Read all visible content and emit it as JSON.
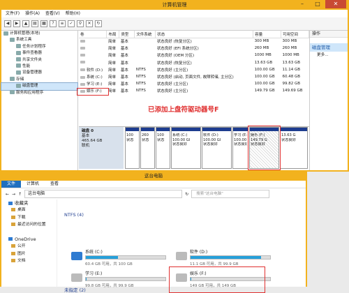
{
  "cm": {
    "title": "计算机管理",
    "menu": [
      "文件(F)",
      "操作(A)",
      "查看(V)",
      "帮助(H)"
    ],
    "tree": [
      {
        "label": "计算机管理(本地)",
        "indent": 0
      },
      {
        "label": "系统工具",
        "indent": 1
      },
      {
        "label": "任务计划程序",
        "indent": 2
      },
      {
        "label": "事件查看器",
        "indent": 2
      },
      {
        "label": "共享文件夹",
        "indent": 2
      },
      {
        "label": "性能",
        "indent": 2
      },
      {
        "label": "设备管理器",
        "indent": 2
      },
      {
        "label": "存储",
        "indent": 1
      },
      {
        "label": "磁盘管理",
        "indent": 2,
        "selected": true
      },
      {
        "label": "服务和应用程序",
        "indent": 1
      }
    ],
    "columns": [
      "卷",
      "布局",
      "类型",
      "文件系统",
      "状态",
      "容量",
      "可用空间"
    ],
    "rows": [
      [
        "",
        "简单",
        "基本",
        "",
        "状态良好 (恢复分区)",
        "300 MB",
        "300 MB"
      ],
      [
        "",
        "简单",
        "基本",
        "",
        "状态良好 (EFI 系统分区)",
        "260 MB",
        "260 MB"
      ],
      [
        "",
        "简单",
        "基本",
        "",
        "状态良好 (OEM 分区)",
        "1000 MB",
        "1000 MB"
      ],
      [
        "",
        "简单",
        "基本",
        "",
        "状态良好 (恢复分区)",
        "13.63 GB",
        "13.63 GB"
      ],
      [
        "软件 (D:)",
        "简单",
        "基本",
        "NTFS",
        "状态良好 (主分区)",
        "100.00 GB",
        "11.14 GB"
      ],
      [
        "系统 (C:)",
        "简单",
        "基本",
        "NTFS",
        "状态良好 (启动, 页面文件, 故障转储, 主分区)",
        "100.00 GB",
        "60.48 GB"
      ],
      [
        "学习 (E:)",
        "简单",
        "基本",
        "NTFS",
        "状态良好 (主分区)",
        "100.00 GB",
        "99.82 GB"
      ],
      [
        "娱乐 (F:)",
        "简单",
        "基本",
        "NTFS",
        "状态良好 (主分区)",
        "149.79 GB",
        "149.69 GB"
      ]
    ],
    "annotation": "已添加上盘符驱动器号F",
    "disk": {
      "name": "磁盘 0",
      "kind": "基本",
      "size": "465.64 GB",
      "status": "联机"
    },
    "partitions": [
      {
        "lines": [
          "",
          "100",
          "状态"
        ],
        "hatch": false
      },
      {
        "lines": [
          "",
          "260",
          "状态"
        ],
        "hatch": false
      },
      {
        "lines": [
          "",
          "100",
          "状态"
        ],
        "hatch": false
      },
      {
        "lines": [
          "系统 (C:)",
          "100.00 GI",
          "状态良好"
        ],
        "hatch": false
      },
      {
        "lines": [
          "软件 (D:)",
          "100.00 GI",
          "状态良好"
        ],
        "hatch": false
      },
      {
        "lines": [
          "学习 (E:)",
          "100.00 GI",
          "状态良好"
        ],
        "hatch": false
      },
      {
        "lines": [
          "娱乐  (F:)",
          "149.79 G",
          "状态良好"
        ],
        "hatch": true
      },
      {
        "lines": [
          "",
          "13.63 G",
          "状态良好"
        ],
        "hatch": false
      }
    ],
    "ops": {
      "header": "操作",
      "section": "磁盘管理",
      "more": "更多..."
    }
  },
  "pc": {
    "title": "这台电脑",
    "tabs": [
      "文件",
      "计算机",
      "查看"
    ],
    "address": "这台电脑",
    "search_placeholder": "搜索\"这台电脑\"",
    "nav": [
      {
        "label": "收藏夹",
        "top": true
      },
      {
        "label": "桌面"
      },
      {
        "label": "下载"
      },
      {
        "label": "最近访问的位置"
      },
      {
        "label": "",
        "spacer": true
      },
      {
        "label": "OneDrive",
        "top": true
      },
      {
        "label": "公开"
      },
      {
        "label": "图片"
      },
      {
        "label": "文档"
      }
    ],
    "section": "NTFS (4)",
    "drives": [
      {
        "name": "系统 (C:)",
        "size": "60.4 GB 可用，共 100 GB",
        "used": 0.4,
        "col": 0,
        "row": 0
      },
      {
        "name": "软件 (D:)",
        "size": "11.1 GB 可用，共 99.9 GB",
        "used": 0.89,
        "col": 1,
        "row": 0
      },
      {
        "name": "学习 (E:)",
        "size": "99.8 GB 可用，共 99.9 GB",
        "used": 0.01,
        "col": 0,
        "row": 1
      },
      {
        "name": "娱乐 (F:)",
        "size": "149 GB 可用，共 149 GB",
        "used": 0.01,
        "col": 1,
        "row": 1
      }
    ],
    "unspecified": "未指定 (2)"
  }
}
